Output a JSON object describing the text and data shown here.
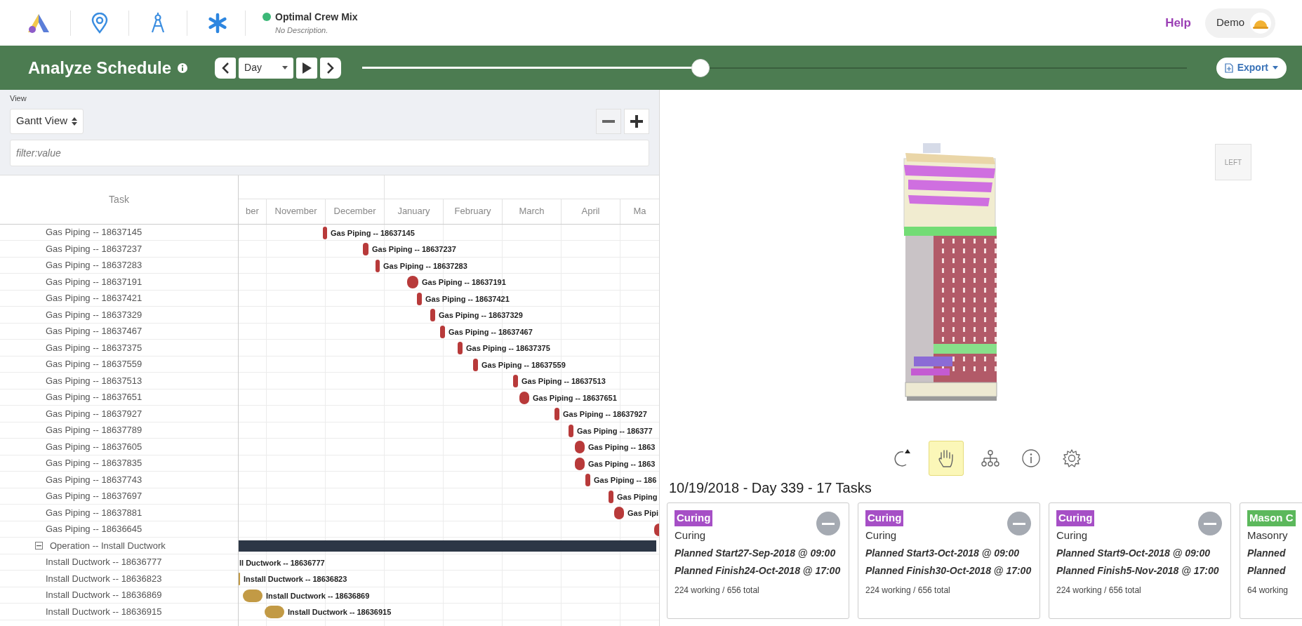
{
  "header": {
    "project": {
      "name": "Optimal Crew Mix",
      "description": "No Description.",
      "color": "#3cb878"
    },
    "help": "Help",
    "user": "Demo"
  },
  "toolbar": {
    "title": "Analyze Schedule",
    "period": "Day",
    "timeline": {
      "level": 0.41
    },
    "export": "Export"
  },
  "view_panel": {
    "view_label": "View",
    "view_select": "Gantt View",
    "filter_placeholder": "filter:value"
  },
  "gantt": {
    "task_header": "Task",
    "months": [
      "ber",
      "November",
      "December",
      "January",
      "February",
      "March",
      "April",
      "Ma"
    ],
    "rows": [
      {
        "kind": "task",
        "label": "Gas Piping -- 18637145",
        "bar_label": "Gas Piping -- 18637145",
        "color": "#b83a3a"
      },
      {
        "kind": "task",
        "label": "Gas Piping -- 18637237",
        "bar_label": "Gas Piping -- 18637237",
        "color": "#b83a3a"
      },
      {
        "kind": "task",
        "label": "Gas Piping -- 18637283",
        "bar_label": "Gas Piping -- 18637283",
        "color": "#b83a3a"
      },
      {
        "kind": "task",
        "label": "Gas Piping -- 18637191",
        "bar_label": "Gas Piping -- 18637191",
        "color": "#b83a3a"
      },
      {
        "kind": "task",
        "label": "Gas Piping -- 18637421",
        "bar_label": "Gas Piping -- 18637421",
        "color": "#b83a3a"
      },
      {
        "kind": "task",
        "label": "Gas Piping -- 18637329",
        "bar_label": "Gas Piping -- 18637329",
        "color": "#b83a3a"
      },
      {
        "kind": "task",
        "label": "Gas Piping -- 18637467",
        "bar_label": "Gas Piping -- 18637467",
        "color": "#b83a3a"
      },
      {
        "kind": "task",
        "label": "Gas Piping -- 18637375",
        "bar_label": "Gas Piping -- 18637375",
        "color": "#b83a3a"
      },
      {
        "kind": "task",
        "label": "Gas Piping -- 18637559",
        "bar_label": "Gas Piping -- 18637559",
        "color": "#b83a3a"
      },
      {
        "kind": "task",
        "label": "Gas Piping -- 18637513",
        "bar_label": "Gas Piping -- 18637513",
        "color": "#b83a3a"
      },
      {
        "kind": "task",
        "label": "Gas Piping -- 18637651",
        "bar_label": "Gas Piping -- 18637651",
        "color": "#b83a3a"
      },
      {
        "kind": "task",
        "label": "Gas Piping -- 18637927",
        "bar_label": "Gas Piping -- 18637927",
        "color": "#b83a3a"
      },
      {
        "kind": "task",
        "label": "Gas Piping -- 18637789",
        "bar_label": "Gas Piping -- 186377",
        "color": "#b83a3a"
      },
      {
        "kind": "task",
        "label": "Gas Piping -- 18637605",
        "bar_label": "Gas Piping -- 1863",
        "color": "#b83a3a"
      },
      {
        "kind": "task",
        "label": "Gas Piping -- 18637835",
        "bar_label": "Gas Piping -- 1863",
        "color": "#b83a3a"
      },
      {
        "kind": "task",
        "label": "Gas Piping -- 18637743",
        "bar_label": "Gas Piping -- 186",
        "color": "#b83a3a"
      },
      {
        "kind": "task",
        "label": "Gas Piping -- 18637697",
        "bar_label": "Gas Piping",
        "color": "#b83a3a"
      },
      {
        "kind": "task",
        "label": "Gas Piping -- 18637881",
        "bar_label": "Gas Pipi",
        "color": "#b83a3a"
      },
      {
        "kind": "task",
        "label": "Gas Piping -- 18636645",
        "color": "#b83a3a"
      },
      {
        "kind": "group",
        "label": "Operation -- Install Ductwork",
        "expanded": true
      },
      {
        "kind": "task",
        "label": "Install Ductwork -- 18636777",
        "bar_label": "ll Ductwork -- 18636777"
      },
      {
        "kind": "task",
        "label": "Install Ductwork -- 18636823",
        "bar_label": "Install Ductwork -- 18636823",
        "color": "#c29a45"
      },
      {
        "kind": "task",
        "label": "Install Ductwork -- 18636869",
        "bar_label": "Install Ductwork -- 18636869",
        "color": "#c29a45"
      },
      {
        "kind": "task",
        "label": "Install Ductwork -- 18636915",
        "bar_label": "Install Ductwork -- 18636915",
        "color": "#c29a45"
      }
    ]
  },
  "model_view": {
    "view_cube": "LEFT",
    "tools": [
      {
        "kind": "orbit",
        "selected": false
      },
      {
        "kind": "pan",
        "selected": true
      },
      {
        "kind": "tree",
        "selected": false
      },
      {
        "kind": "info",
        "selected": false
      },
      {
        "kind": "settings",
        "selected": false
      }
    ]
  },
  "day_summary": {
    "title": "10/19/2018 - Day 339 - 17 Tasks",
    "cards": [
      {
        "tag": "Curing",
        "color": "#a64fc6",
        "name": "Curing",
        "start": "Planned Start27-Sep-2018 @ 09:00",
        "finish": "Planned Finish24-Oct-2018 @ 17:00",
        "crew": "224 working / 656 total"
      },
      {
        "tag": "Curing",
        "color": "#a64fc6",
        "name": "Curing",
        "start": "Planned Start3-Oct-2018 @ 09:00",
        "finish": "Planned Finish30-Oct-2018 @ 17:00",
        "crew": "224 working / 656 total"
      },
      {
        "tag": "Curing",
        "color": "#a64fc6",
        "name": "Curing",
        "start": "Planned Start9-Oct-2018 @ 09:00",
        "finish": "Planned Finish5-Nov-2018 @ 17:00",
        "crew": "224 working / 656 total"
      },
      {
        "tag": "Mason C",
        "color": "#5cb85c",
        "name": "Masonry",
        "start": "Planned",
        "finish": "Planned",
        "crew": "64 working"
      }
    ]
  }
}
